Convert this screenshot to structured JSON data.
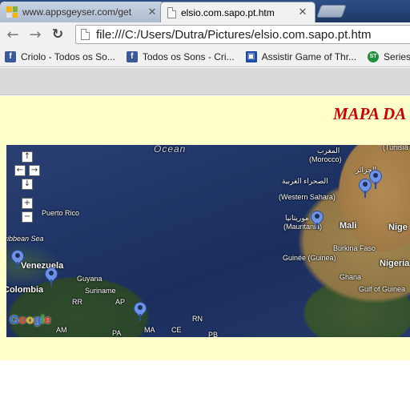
{
  "tabs": [
    {
      "title": "www.appsgeyser.com/get",
      "active": false
    },
    {
      "title": "elsio.com.sapo.pt.htm",
      "active": true
    }
  ],
  "toolbar": {
    "url": "file:///C:/Users/Dutra/Pictures/elsio.com.sapo.pt.htm"
  },
  "bookmarks": [
    {
      "label": "Criolo - Todos os So...",
      "icon": "facebook-icon"
    },
    {
      "label": "Todos os Sons - Cri...",
      "icon": "facebook-icon"
    },
    {
      "label": "Assistir Game of Thr...",
      "icon": "film-icon"
    },
    {
      "label": "Series",
      "icon": "st-icon"
    }
  ],
  "page": {
    "heading": "MAPA DA"
  },
  "map": {
    "labels": {
      "ocean": "Ocean",
      "morocco_ar": "المغرب",
      "morocco": "(Morocco)",
      "western_sahara_ar": "الصحراء الغربية",
      "western_sahara": "(Western Sahara)",
      "mauritania_ar": "موريتانيا",
      "mauritania": "(Mauritania)",
      "mali": "Mali",
      "niger": "Nige",
      "tunisia": "(Tunisia",
      "algeria_ar": "الجزائر",
      "puerto_rico": "Puerto Rico",
      "caribbean": "ribbean Sea",
      "venezuela": "Venezuela",
      "guyana": "Guyana",
      "suriname": "Suriname",
      "colombia": "Colombia",
      "rr": "RR",
      "ap": "AP",
      "am": "AM",
      "pa": "PA",
      "ma": "MA",
      "ce": "CE",
      "rn": "RN",
      "pb": "PB",
      "guinee": "Guinée (Guinea)",
      "burkina": "Burkina Faso",
      "ghana": "Ghana",
      "nigeria": "Nigeria",
      "gulf": "Gulf of Guinea"
    },
    "markers": [
      {
        "place": "Algeria A"
      },
      {
        "place": "Algeria B"
      },
      {
        "place": "Mauritania"
      },
      {
        "place": "Colombia coast"
      },
      {
        "place": "Venezuela"
      },
      {
        "place": "Maranhão"
      }
    ],
    "logo": "Google",
    "marker_color": "#6e93e6"
  },
  "colors": {
    "heading": "#cc0000",
    "page_bg": "#ffffcc",
    "tabstrip": "#2d4f86"
  }
}
